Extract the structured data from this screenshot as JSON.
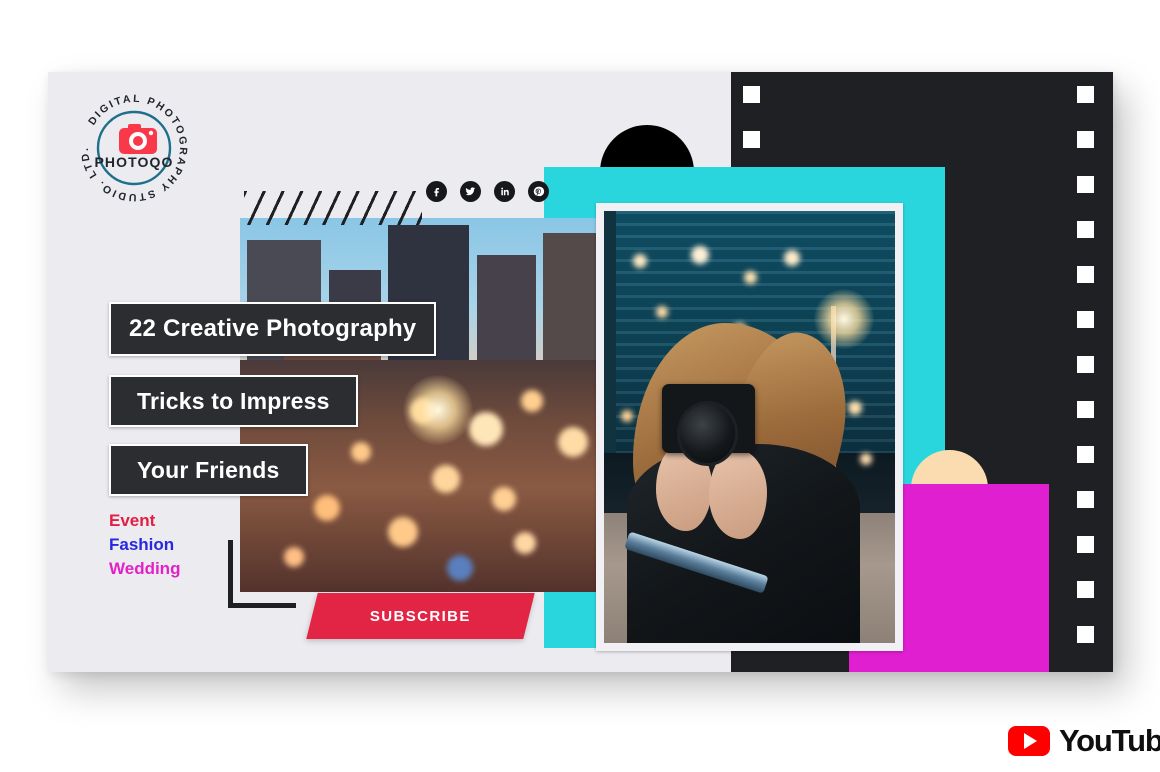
{
  "brand": {
    "logo_arc_text": "DIGITAL PHOTOGRAPHY STUDIO. LTD.",
    "logo_name": "PHOTOQO",
    "logo_ring_color": "#1d6f8c",
    "logo_camera_color": "#f9384a"
  },
  "social": {
    "items": [
      {
        "name": "facebook",
        "glyph": "f"
      },
      {
        "name": "twitter",
        "glyph": "t"
      },
      {
        "name": "linkedin",
        "glyph": "in"
      },
      {
        "name": "pinterest",
        "glyph": "P"
      }
    ]
  },
  "headline": {
    "line1": "22 Creative Photography",
    "line2": "Tricks to Impress",
    "line3": "Your Friends"
  },
  "categories": [
    {
      "label": "Event",
      "color": "#e31e45"
    },
    {
      "label": "Fashion",
      "color": "#2828e0"
    },
    {
      "label": "Wedding",
      "color": "#e321c8"
    }
  ],
  "cta": {
    "subscribe_label": "SUBSCRIBE",
    "color": "#e32545"
  },
  "youtube": {
    "wordmark": "YouTube",
    "badge_color": "#ff0000"
  },
  "palette": {
    "card_bg": "#ebebf0",
    "dark": "#1f2023",
    "cyan": "#2ad6dd",
    "magenta": "#df1fd0",
    "cream": "#fadcb0",
    "headline_bg": "#2b2d30"
  }
}
